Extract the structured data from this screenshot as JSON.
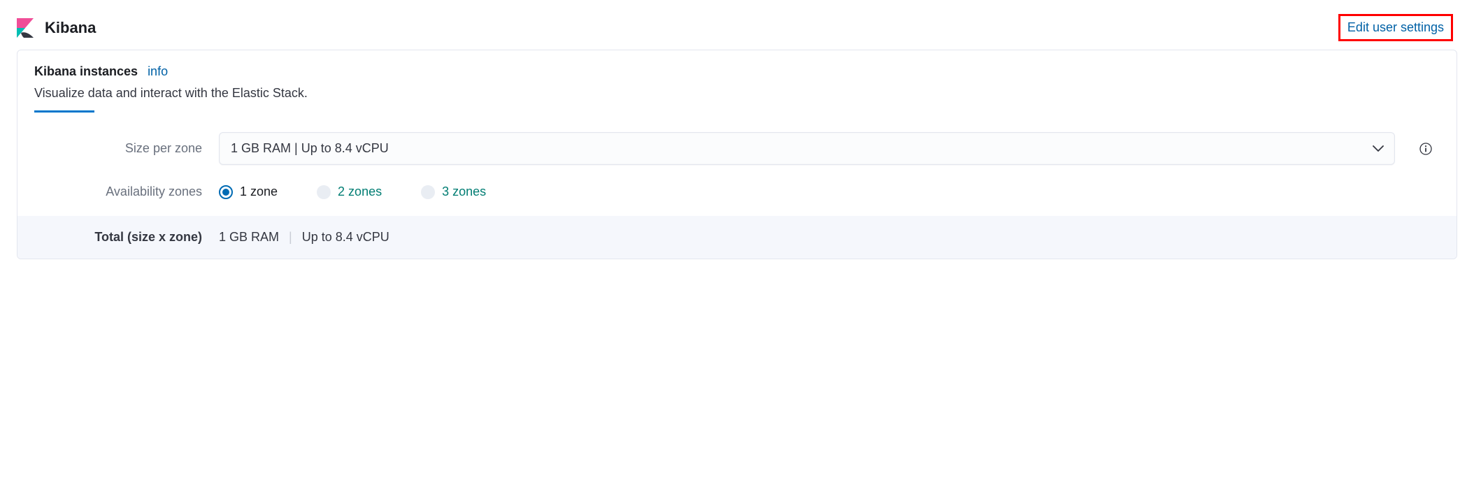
{
  "header": {
    "title": "Kibana",
    "edit_link": "Edit user settings"
  },
  "card": {
    "title": "Kibana instances",
    "info_link": "info",
    "subtitle": "Visualize data and interact with the Elastic Stack."
  },
  "form": {
    "size_label": "Size per zone",
    "size_value": "1 GB RAM | Up to 8.4 vCPU",
    "zones_label": "Availability zones",
    "zone_options": {
      "opt1": "1 zone",
      "opt2": "2 zones",
      "opt3": "3 zones"
    }
  },
  "total": {
    "label": "Total (size x zone)",
    "ram": "1 GB RAM",
    "cpu": "Up to 8.4 vCPU"
  }
}
